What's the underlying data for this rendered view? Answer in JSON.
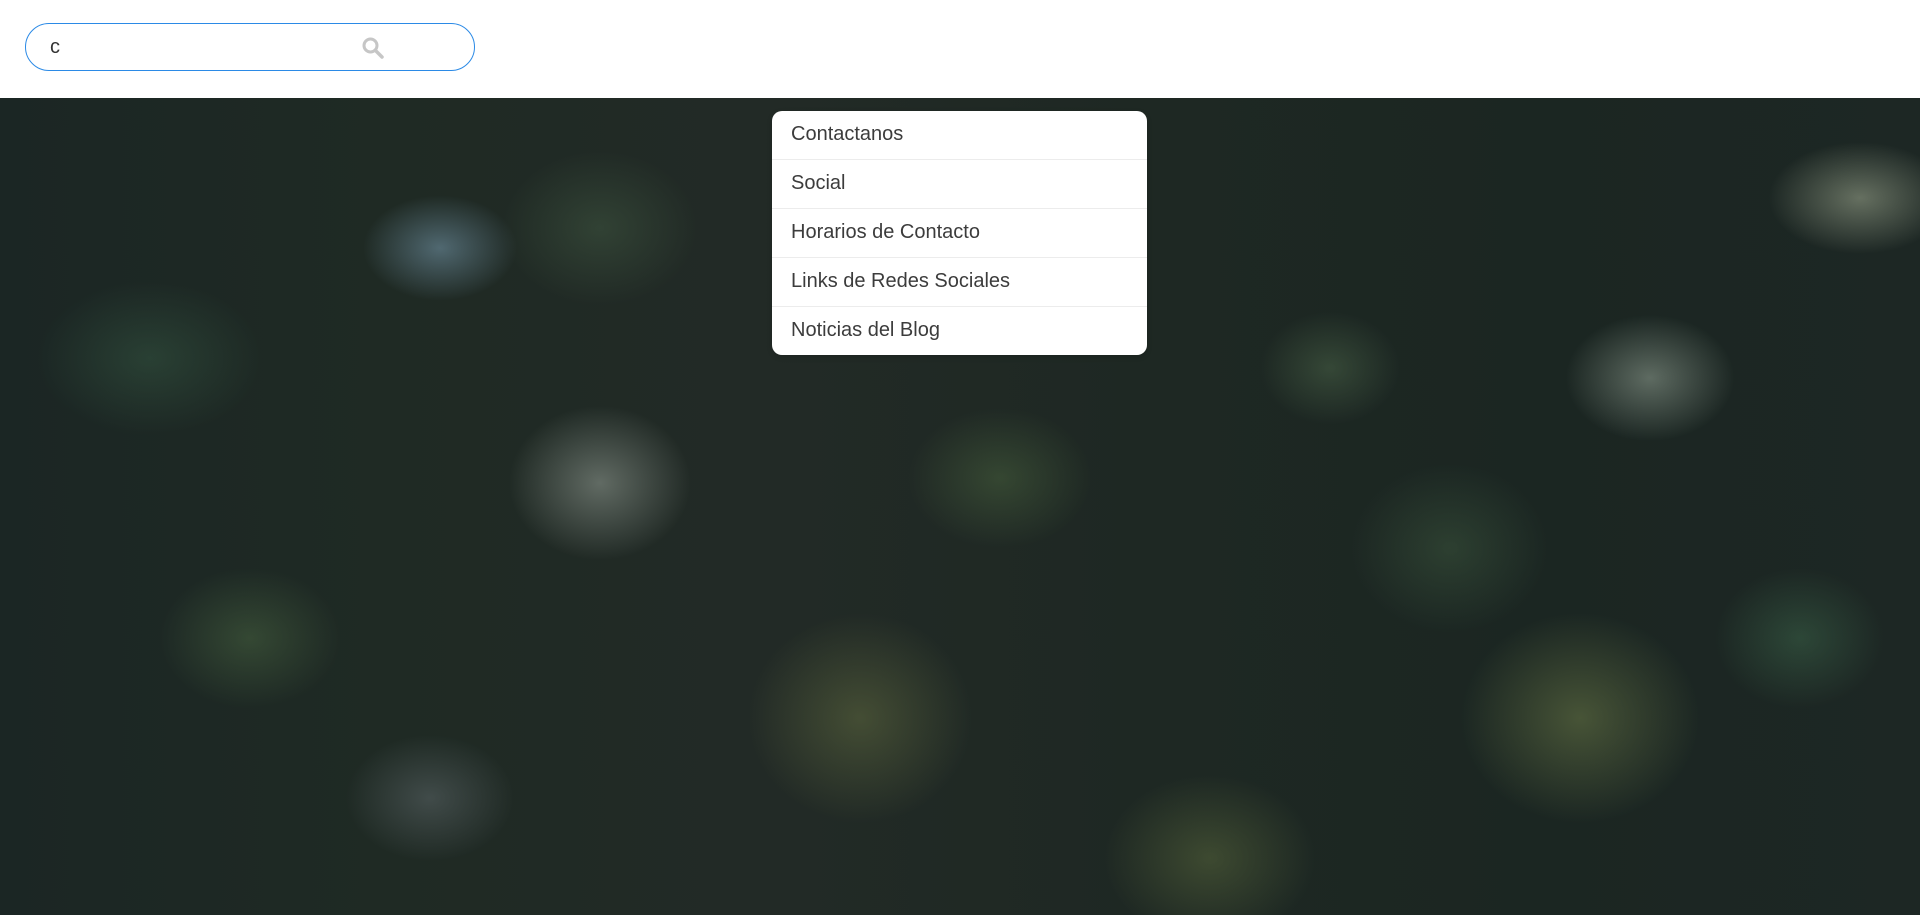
{
  "search": {
    "value": "c",
    "icon": "search-icon",
    "border_color": "#2b8ae6"
  },
  "suggestions": [
    {
      "label": "Contactanos"
    },
    {
      "label": "Social"
    },
    {
      "label": "Horarios de Contacto"
    },
    {
      "label": "Links de Redes Sociales"
    },
    {
      "label": "Noticias del Blog"
    }
  ]
}
